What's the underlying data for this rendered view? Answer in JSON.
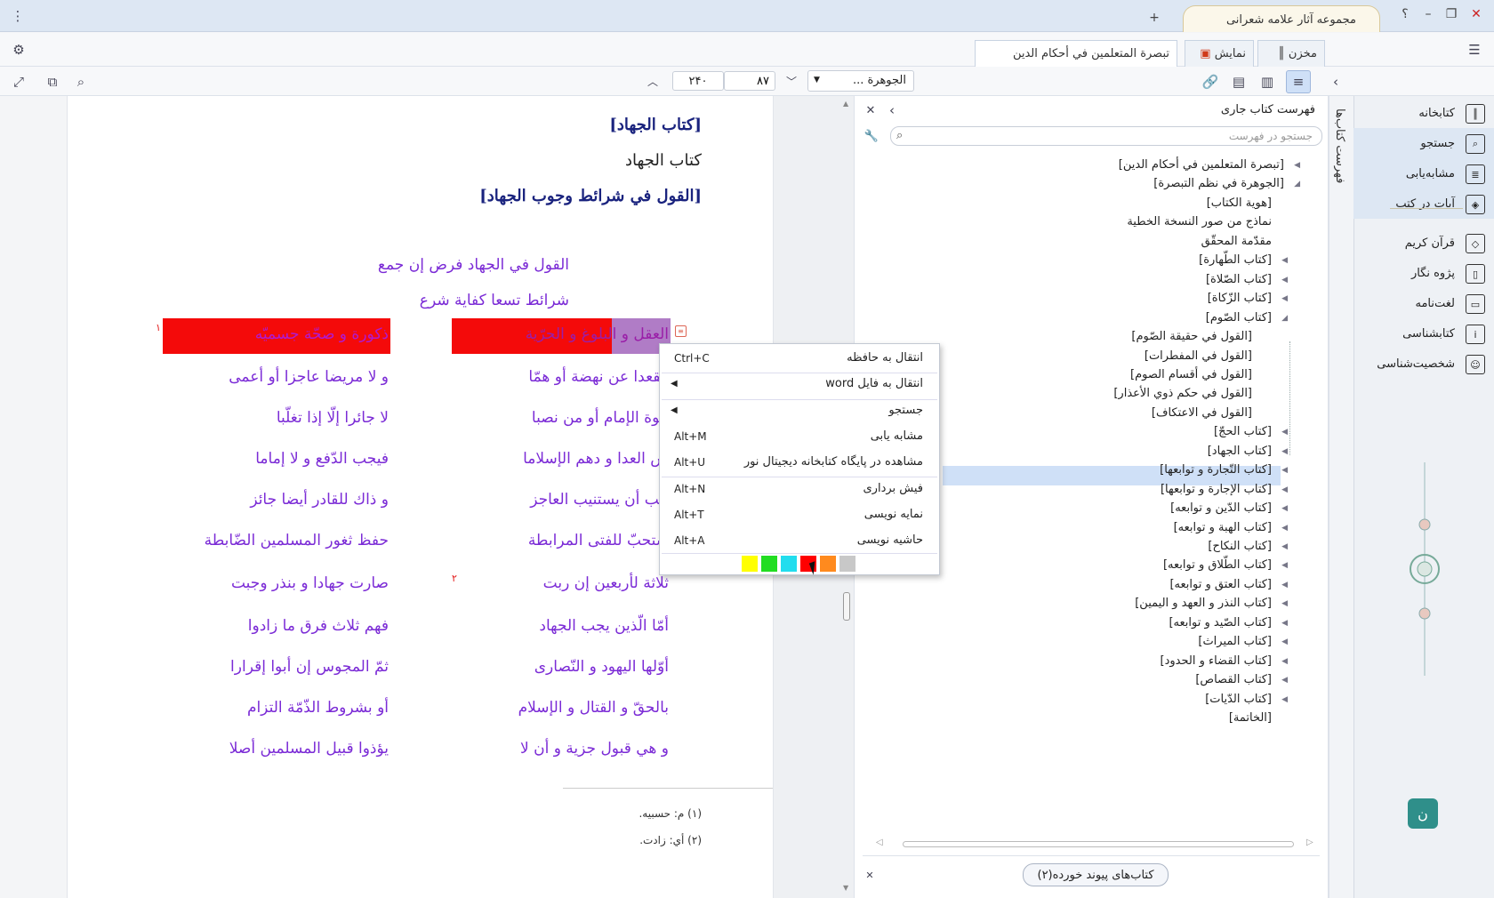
{
  "window": {
    "title": "مجموعه آثار علامه شعرانی",
    "new_tab": "+",
    "help": "؟"
  },
  "tabs": {
    "book_title": "تبصرة المتعلمين في أحكام الدين",
    "display": "نمایش",
    "repository": "مخزن"
  },
  "toolbar": {
    "book_select": "الجوهرة ...",
    "page_current": "۸۷",
    "page_total": "۲۴۰"
  },
  "sidebar": {
    "items": [
      {
        "label": "کتابخانه",
        "icon": "library-icon"
      },
      {
        "label": "جستجو",
        "icon": "search-icon"
      },
      {
        "label": "مشابه‌یابی",
        "icon": "similarity-icon"
      },
      {
        "label": "آیات در کتب",
        "icon": "verses-icon"
      },
      {
        "label": "قرآن کریم",
        "icon": "quran-icon"
      },
      {
        "label": "پژوه نگار",
        "icon": "research-icon"
      },
      {
        "label": "لغت‌نامه",
        "icon": "dictionary-icon"
      },
      {
        "label": "کتابشناسی",
        "icon": "bibliography-icon"
      },
      {
        "label": "شخصیت‌شناسی",
        "icon": "person-icon"
      }
    ],
    "vertical_tab": "فهرست کتاب‌ها"
  },
  "toc": {
    "header": "فهرست کتاب جاری",
    "search_placeholder": "جستجو در فهرست",
    "linked_books": "کتاب‌های پیوند خورده(۲)",
    "nodes": [
      "[تبصرة المتعلمين في أحكام الدين]",
      "[الجوهرة في نظم التبصرة]",
      "[هوية الكتاب]",
      "نماذج من صور النسخة الخطية",
      "مقدّمة المحقّق",
      "[كتاب الطّهارة]",
      "[كتاب الصّلاة]",
      "[كتاب الزّكاة]",
      "[كتاب الصّوم]",
      "[القول في حقيقة الصّوم]",
      "[القول في المفطرات]",
      "[القول في أقسام الصوم]",
      "[القول في حكم ذوي الأعذار]",
      "[القول في الاعتكاف]",
      "[كتاب الحجّ]",
      "[كتاب الجهاد]",
      "[كتاب التّجارة و توابعها]",
      "[كتاب الإجارة و توابعها]",
      "[كتاب الدّين و توابعه]",
      "[كتاب الهبة و توابعه]",
      "[كتاب النكاح]",
      "[كتاب الطّلاق و توابعه]",
      "[كتاب العتق و توابعه]",
      "[كتاب النذر و العهد و اليمين]",
      "[كتاب الصّيد و توابعه]",
      "[كتاب الميراث]",
      "[كتاب القضاء و الحدود]",
      "[كتاب القصاص]",
      "[كتاب الدّيات]",
      "[الخاتمة]"
    ]
  },
  "document": {
    "h1": "[كتاب الجهاد]",
    "h1_plain": "كتاب الجهاد",
    "h2": "[القول في شرائط وجوب الجهاد]",
    "intro": [
      "القول في الجهاد فرض إن جمع",
      "شرائط تسعا كفاية شرع"
    ],
    "right_col": [
      "العقل و البلوغ و الحرّية",
      "مقعدا عن نهضة أو همّا",
      "عوة الإمام أو من نصبا",
      "ش العدا و دهم الإسلاما",
      "جب أن يستنيب العاجز",
      "ستحبّ للفتى المرابطة",
      "ثلاثة لأربعين إن ربت",
      "أمّا الّذين يجب الجهاد",
      "أوّلها اليهود و النّصارى",
      "بالحقّ و القتال و الإسلام",
      "و هي قبول جزية و أن لا"
    ],
    "left_col": [
      "ذكورة و صحّة جسميّه",
      "و لا مريضا عاجزا أو أعمى",
      "لا جائرا إلّا إذا تغلّبا",
      "فيجب الدّفع و لا إماما",
      "و ذاك للقادر أيضا جائز",
      "حفظ ثغور المسلمين الضّابطة",
      "صارت جهادا و بنذر وجبت",
      "فهم ثلاث فرق ما زادوا",
      "ثمّ المجوس إن أبوا إقرارا",
      "أو بشروط الذّمّة التزام",
      "يؤذوا قبيل المسلمين أصلا"
    ],
    "sup1": "١",
    "sup2": "٢",
    "footnotes": [
      "(١) م: حسبيه.",
      "(٢) أي: زادت."
    ]
  },
  "context_menu": {
    "items": [
      {
        "label": "انتقال به حافظه",
        "shortcut": "Ctrl+C"
      },
      {
        "label": "انتقال به فایل word",
        "shortcut": ""
      },
      {
        "label": "جستجو",
        "shortcut": ""
      },
      {
        "label": "مشابه یابی",
        "shortcut": "Alt+M"
      },
      {
        "label": "مشاهده در پایگاه کتابخانه دیجیتال نور",
        "shortcut": "Alt+U"
      },
      {
        "label": "فیش برداری",
        "shortcut": "Alt+N"
      },
      {
        "label": "نمایه نویسی",
        "shortcut": "Alt+T"
      },
      {
        "label": "حاشیه نویسی",
        "shortcut": "Alt+A"
      }
    ],
    "colors": [
      "#ffff00",
      "#22dd22",
      "#22ddee",
      "#ff0000",
      "#ff8a1e",
      "#c8c8c8"
    ]
  }
}
